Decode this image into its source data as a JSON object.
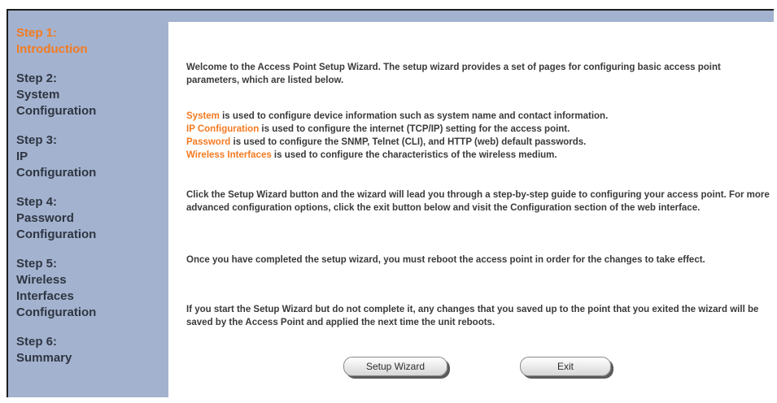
{
  "sidebar": {
    "steps": [
      {
        "lines": [
          "Step 1:",
          "Introduction"
        ],
        "active": true
      },
      {
        "lines": [
          "Step 2:",
          "System",
          "Configuration"
        ],
        "active": false
      },
      {
        "lines": [
          "Step 3:",
          "IP",
          "Configuration"
        ],
        "active": false
      },
      {
        "lines": [
          "Step 4:",
          "Password",
          "Configuration"
        ],
        "active": false
      },
      {
        "lines": [
          "Step 5:",
          "Wireless",
          "Interfaces",
          "Configuration"
        ],
        "active": false
      },
      {
        "lines": [
          "Step 6:",
          "Summary"
        ],
        "active": false
      }
    ]
  },
  "content": {
    "intro": "Welcome to the Access Point Setup Wizard. The setup wizard provides a set of pages for configuring basic access point parameters, which are listed below.",
    "items": [
      {
        "keyword": "System",
        "text": " is used to configure device information such as system name and contact information."
      },
      {
        "keyword": "IP Configuration",
        "text": " is used to configure the internet (TCP/IP) setting for the access point."
      },
      {
        "keyword": "Password",
        "text": " is used to configure the SNMP, Telnet (CLI), and HTTP (web) default passwords."
      },
      {
        "keyword": "Wireless Interfaces",
        "text": " is used to configure the characteristics of the wireless medium."
      }
    ],
    "guide": "Click the Setup Wizard button and the wizard will lead you through a step-by-step guide to configuring your access point. For more advanced configuration options, click the exit button below and visit the Configuration section of the web interface.",
    "reboot": "Once you have completed the setup wizard, you must reboot the access point in order for the changes to take effect.",
    "incomplete": "If you start the Setup Wizard but do not complete it, any changes that you saved up to the point that you exited the wizard will be saved by the Access Point and applied the next time the unit reboots."
  },
  "buttons": {
    "setup_wizard": "Setup Wizard",
    "exit": "Exit"
  },
  "colors": {
    "sidebar_bg": "#a3b3cf",
    "active_step": "#f47a20",
    "keyword": "#f47a20"
  }
}
